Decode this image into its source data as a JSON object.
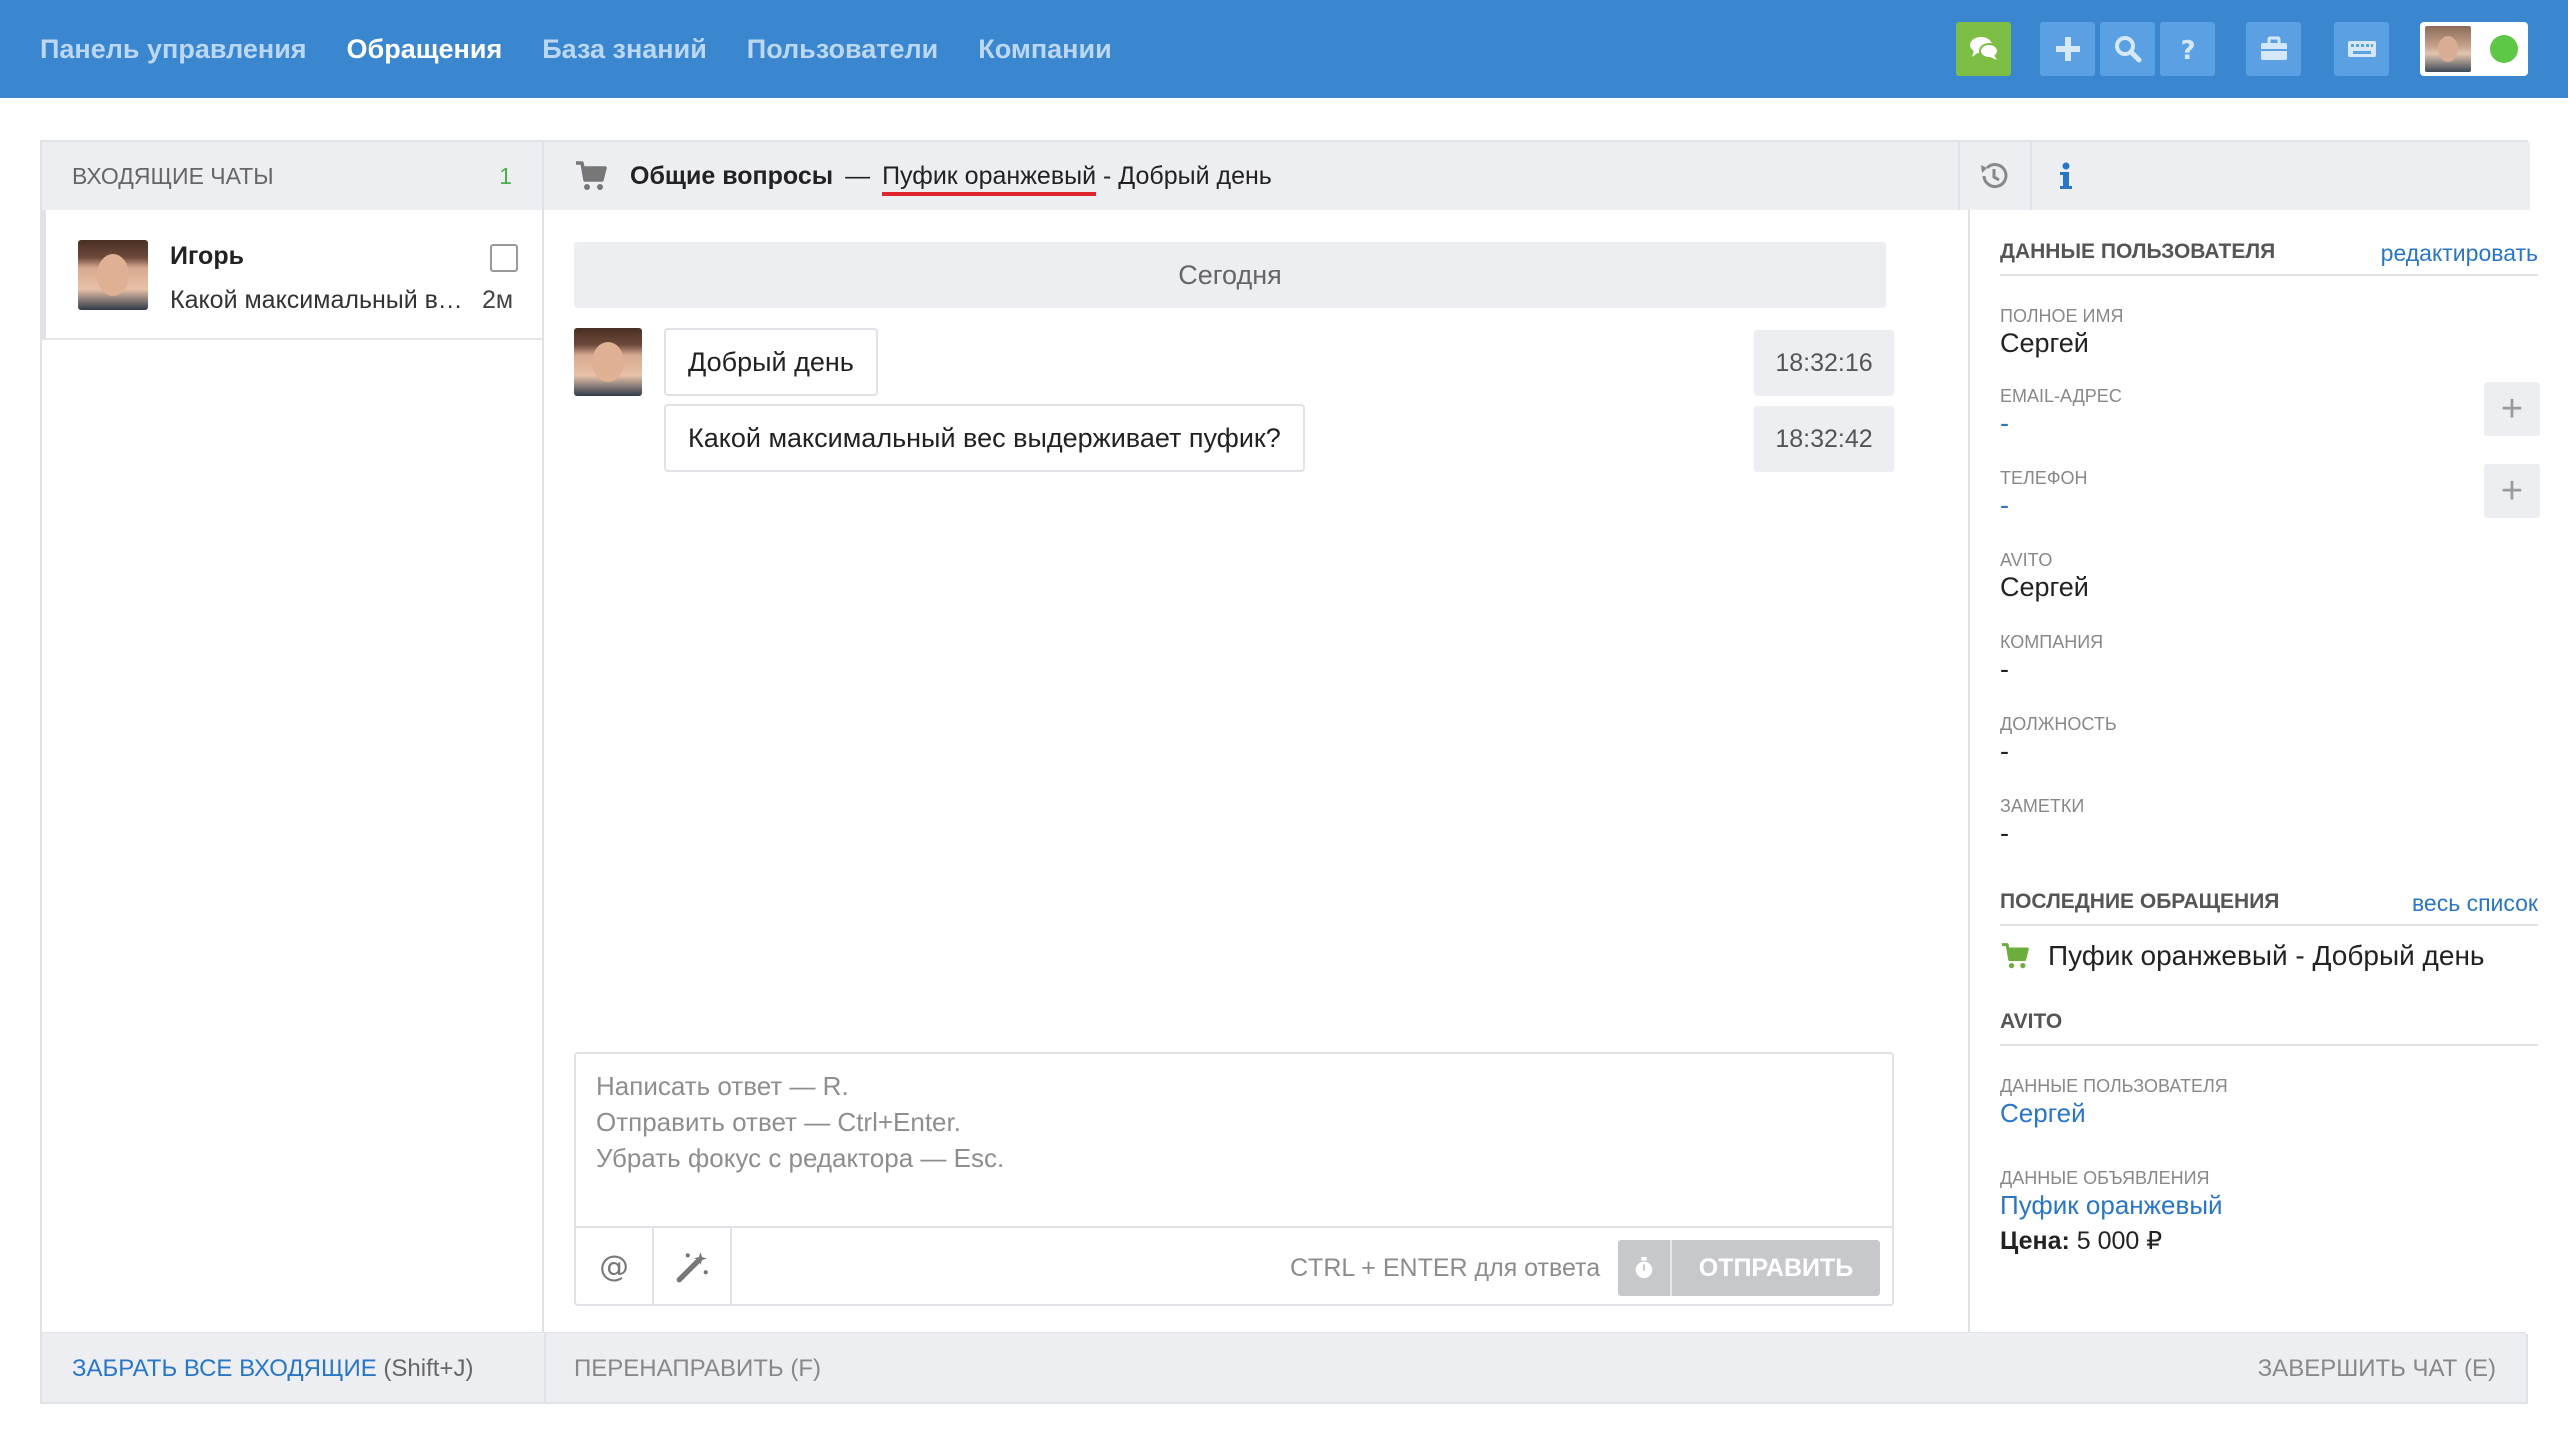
{
  "nav": {
    "items": [
      {
        "label": "Панель управления",
        "active": false
      },
      {
        "label": "Обращения",
        "active": true
      },
      {
        "label": "База знаний",
        "active": false
      },
      {
        "label": "Пользователи",
        "active": false
      },
      {
        "label": "Компании",
        "active": false
      }
    ]
  },
  "toolbar": {
    "icons": [
      "chat-bubbles-icon",
      "plus-icon",
      "search-icon",
      "help-icon",
      "briefcase-icon",
      "keyboard-icon"
    ],
    "status_color": "#5fc746"
  },
  "inbox": {
    "title": "Входящие чаты",
    "count": "1",
    "chats": [
      {
        "name": "Игорь",
        "preview": "Какой максимальный вес выдерживает пуфик?",
        "time": "2м"
      }
    ]
  },
  "conversation": {
    "category": "Общие вопросы",
    "separator": "—",
    "subject_link": "Пуфик оранжевый",
    "subject_rest": " - Добрый день",
    "day_label": "Сегодня",
    "messages": [
      {
        "text": "Добрый день",
        "time": "18:32:16"
      },
      {
        "text": "Какой максимальный вес выдерживает пуфик?",
        "time": "18:32:42"
      }
    ]
  },
  "editor": {
    "placeholder": "Написать ответ — R.\nОтправить ответ — Ctrl+Enter.\nУбрать фокус с редактора — Esc.",
    "hint": "CTRL + ENTER для ответа",
    "send_label": "ОТПРАВИТЬ"
  },
  "user_panel": {
    "title": "Данные пользователя",
    "edit_link": "редактировать",
    "fields": {
      "full_name_label": "Полное имя",
      "full_name": "Сергей",
      "email_label": "Email-адрес",
      "email": "-",
      "phone_label": "Телефон",
      "phone": "-",
      "avito_label": "Avito",
      "avito": "Сергей",
      "company_label": "Компания",
      "company": "-",
      "position_label": "Должность",
      "position": "-",
      "notes_label": "Заметки",
      "notes": "-"
    },
    "recent_title": "Последние обращения",
    "recent_link": "весь список",
    "recent_item": "Пуфик оранжевый - Добрый день",
    "avito_section": "Avito",
    "avito_user_label": "Данные пользователя",
    "avito_user": "Сергей",
    "ad_label": "Данные объявления",
    "ad_title": "Пуфик оранжевый",
    "price_label": "Цена:",
    "price_value": "5 000 ₽"
  },
  "footer": {
    "take_all": "ЗАБРАТЬ ВСЕ ВХОДЯЩИЕ",
    "take_all_key": "(Shift+J)",
    "redirect": "ПЕРЕНАПРАВИТЬ (F)",
    "finish": "ЗАВЕРШИТЬ ЧАТ (E)"
  }
}
